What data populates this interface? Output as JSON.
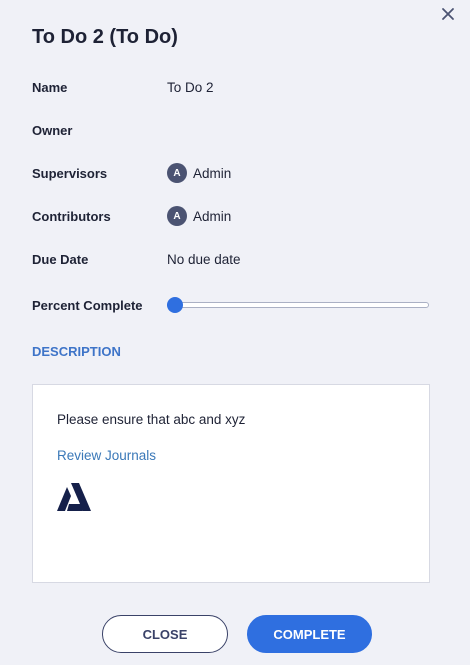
{
  "dialog": {
    "title": "To Do 2 (To Do)",
    "close_icon": "close-icon"
  },
  "fields": {
    "name": {
      "label": "Name",
      "value": "To Do 2"
    },
    "owner": {
      "label": "Owner",
      "value": ""
    },
    "supervisors": {
      "label": "Supervisors",
      "avatar_initial": "A",
      "value": "Admin"
    },
    "contributors": {
      "label": "Contributors",
      "avatar_initial": "A",
      "value": "Admin"
    },
    "due_date": {
      "label": "Due Date",
      "value": "No due date"
    },
    "percent_complete": {
      "label": "Percent Complete",
      "value": 0
    }
  },
  "description": {
    "heading": "DESCRIPTION",
    "text": "Please ensure that abc and xyz",
    "link_text": "Review Journals",
    "logo_icon": "logo-a-icon"
  },
  "buttons": {
    "close_label": "CLOSE",
    "complete_label": "COMPLETE"
  },
  "colors": {
    "accent": "#2f6fe0",
    "heading_blue": "#3e74c8",
    "link": "#3a78b8",
    "avatar_bg": "#4b5372",
    "background": "#f0f1f7"
  }
}
